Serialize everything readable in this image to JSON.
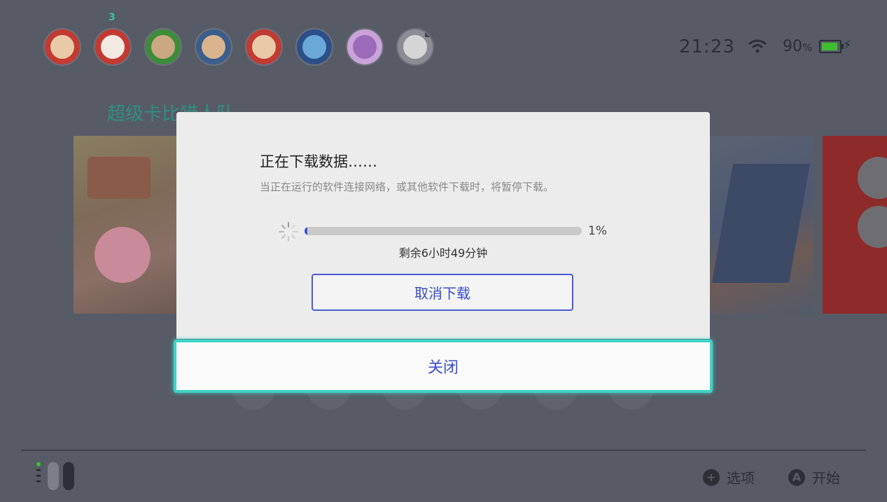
{
  "topbar": {
    "user_badge_count": "3",
    "friend_notification": "1",
    "time": "21:23",
    "battery_percent": "90",
    "battery_unit": "%",
    "battery_level": 0.9
  },
  "home": {
    "game_title": "超级卡比猎人队",
    "tiles": [
      {
        "name": "kirby"
      },
      {
        "name": "pokemon"
      },
      {
        "name": "snes"
      }
    ]
  },
  "dialog": {
    "title": "正在下载数据……",
    "description": "当正在运行的软件连接网络，或其他软件下载时，将暂停下载。",
    "progress_percent": 1,
    "progress_label": "1%",
    "remaining": "剩余6小时49分钟",
    "cancel_label": "取消下载",
    "close_label": "关闭"
  },
  "footer": {
    "options_label": "选项",
    "options_key": "+",
    "start_label": "开始",
    "start_key": "A"
  },
  "colors": {
    "accent_blue": "#3a4dc9",
    "focus_teal": "#3fd3c6",
    "battery_green": "#3fbf2f"
  }
}
